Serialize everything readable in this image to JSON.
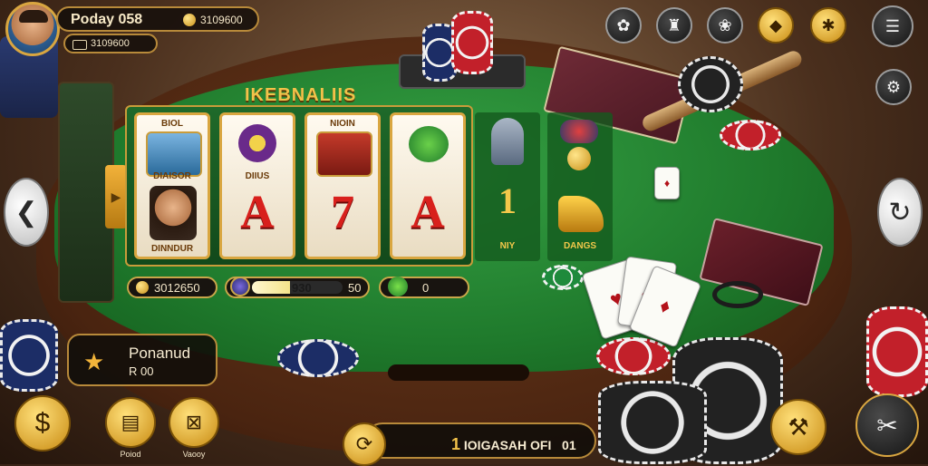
{
  "player": {
    "name": "Poday 058",
    "balance": "3109600",
    "id_label": "3109600"
  },
  "top_icons": [
    "flower-icon",
    "trophy-icon",
    "gift-icon",
    "shield-icon",
    "settings-icon",
    "menu-list-icon"
  ],
  "slot": {
    "title": "IKEBNALIIS",
    "reels": [
      {
        "top_label": "BIOL",
        "sub_label": "DIAISOR",
        "bottom_label": "DINNDUR"
      },
      {
        "top_label": "",
        "sub_label": "DIIUS",
        "big_symbol": "A"
      },
      {
        "top_label": "NIOIN",
        "sub_label": "",
        "big_symbol": "7"
      },
      {
        "top_label": "",
        "sub_label": "",
        "big_symbol": "A"
      }
    ],
    "side_columns": [
      {
        "big_symbol": "1",
        "label": "NIY"
      },
      {
        "big_symbol": "",
        "label": "DANGS"
      }
    ],
    "lever_symbol": "▶"
  },
  "stats": {
    "coins": "3012650",
    "progress_value": "930",
    "progress_right": "50",
    "progress_fraction": 0.42,
    "gems": "0"
  },
  "pot": {
    "label": "Ponanud",
    "amount": "R 00"
  },
  "bottom_bar": {
    "digit": "1",
    "text": "IOIGASAH",
    "suffix": "OFI",
    "count": "01"
  },
  "bottom_buttons": {
    "left_1": "Poiod",
    "left_2": "Vaooy"
  },
  "colors": {
    "felt": "#1f7a2c",
    "gold": "#d9a640",
    "wood": "#4a2410"
  }
}
